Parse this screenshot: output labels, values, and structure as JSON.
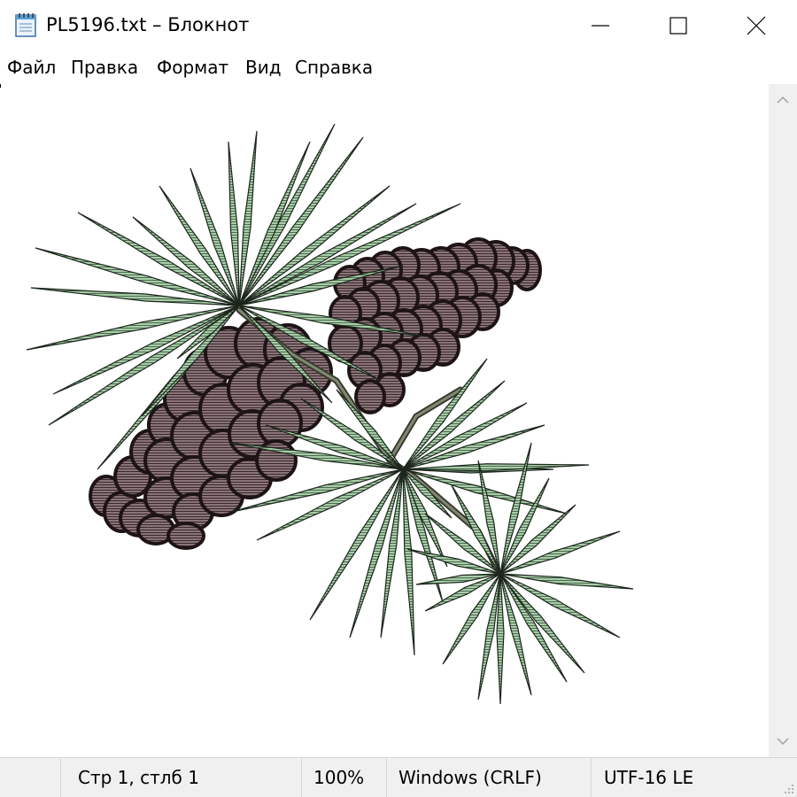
{
  "window": {
    "title": "PL5196.txt – Блокнот",
    "icons": {
      "app": "notepad-icon",
      "minimize": "minimize-icon",
      "maximize": "maximize-icon",
      "close": "close-icon"
    }
  },
  "menu": [
    "Файл",
    "Правка",
    "Формат",
    "Вид",
    "Справка"
  ],
  "editor": {
    "content": "ASCII-art image of a pine branch with two pine cones",
    "colors": {
      "needles": "#a8cca8",
      "cone": "#8a7478",
      "outline": "#1e1416"
    }
  },
  "status": {
    "position": "Стр 1, стлб 1",
    "zoom": "100%",
    "line_endings": "Windows (CRLF)",
    "encoding": "UTF-16 LE"
  }
}
